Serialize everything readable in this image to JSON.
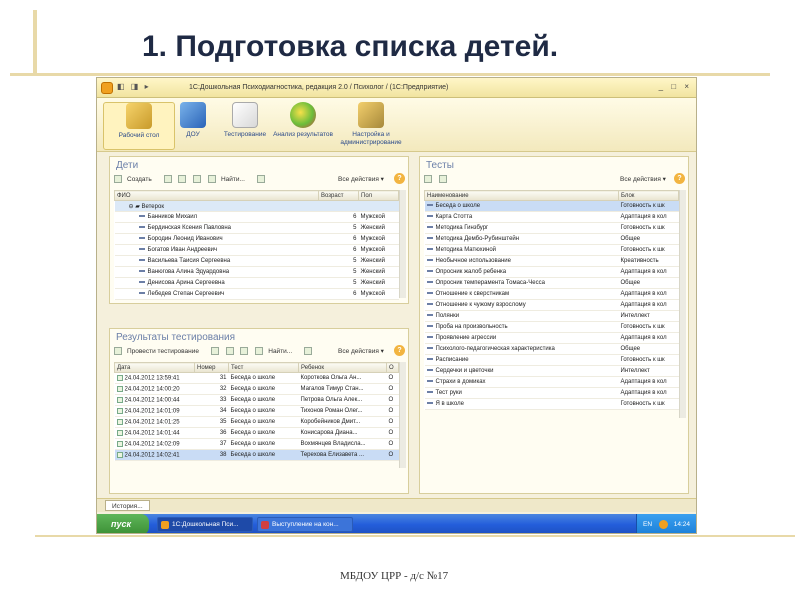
{
  "slide": {
    "title": "1. Подготовка списка детей.",
    "footer": "МБДОУ ЦРР - д/с №17"
  },
  "window": {
    "title": "1С:Дошкольная Психодиагностика, редакция 2.0 / Психолог / (1С:Предприятие)",
    "window_controls": "_ □ ×"
  },
  "toolbar": [
    {
      "label": "Рабочий стол",
      "icon": "desk-icon"
    },
    {
      "label": "ДОУ",
      "icon": "building-icon"
    },
    {
      "label": "Тестирование",
      "icon": "test-sheet-icon"
    },
    {
      "label": "Анализ результатов",
      "icon": "analysis-icon"
    },
    {
      "label": "Настройка и администрирование",
      "icon": "settings-icon"
    }
  ],
  "children_panel": {
    "title": "Дети",
    "create_label": "Создать",
    "find_label": "Найти...",
    "all_actions": "Все действия ▾",
    "columns": [
      "ФИО",
      "Возраст",
      "Пол"
    ],
    "group": "Ветерок",
    "rows": [
      {
        "name": "Банников Михаил",
        "age": "6",
        "sex": "Мужской"
      },
      {
        "name": "Бердинская Ксения Павловна",
        "age": "5",
        "sex": "Женский"
      },
      {
        "name": "Бородин Леонид Иванович",
        "age": "6",
        "sex": "Мужской"
      },
      {
        "name": "Богатов Иван Андреевич",
        "age": "6",
        "sex": "Мужской"
      },
      {
        "name": "Васильева Таисия Сергеевна",
        "age": "5",
        "sex": "Женский"
      },
      {
        "name": "Ванюгова Алина Эдуардовна",
        "age": "5",
        "sex": "Женский"
      },
      {
        "name": "Денисова Арина Сергеевна",
        "age": "5",
        "sex": "Женский"
      },
      {
        "name": "Лебедев Степан Сергеевич",
        "age": "6",
        "sex": "Мужской"
      }
    ]
  },
  "results_panel": {
    "title": "Результаты тестирования",
    "run_label": "Провести тестирование",
    "find_label": "Найти...",
    "all_actions": "Все действия ▾",
    "columns": [
      "Дата",
      "Номер",
      "Тест",
      "Ребенок",
      "О"
    ],
    "rows": [
      {
        "date": "24.04.2012 13:59:41",
        "num": "31",
        "test": "Беседа о школе",
        "child": "Короткова Ольга Ан...",
        "o": "О"
      },
      {
        "date": "24.04.2012 14:00:20",
        "num": "32",
        "test": "Беседа о школе",
        "child": "Магалов Тимур Стан...",
        "o": "О"
      },
      {
        "date": "24.04.2012 14:00:44",
        "num": "33",
        "test": "Беседа о школе",
        "child": "Петрова Ольга Алек...",
        "o": "О"
      },
      {
        "date": "24.04.2012 14:01:09",
        "num": "34",
        "test": "Беседа о школе",
        "child": "Тихонов Роман Олег...",
        "o": "О"
      },
      {
        "date": "24.04.2012 14:01:25",
        "num": "35",
        "test": "Беседа о школе",
        "child": "Коробейников Дмит...",
        "o": "О"
      },
      {
        "date": "24.04.2012 14:01:44",
        "num": "36",
        "test": "Беседа о школе",
        "child": "Конисарова Диана...",
        "o": "О"
      },
      {
        "date": "24.04.2012 14:02:09",
        "num": "37",
        "test": "Беседа о школе",
        "child": "Вохмянцев Владисла...",
        "o": "О"
      },
      {
        "date": "24.04.2012 14:02:41",
        "num": "38",
        "test": "Беседа о школе",
        "child": "Терехова Елизавета ...",
        "o": "О"
      }
    ]
  },
  "tests_panel": {
    "title": "Тесты",
    "all_actions": "Все действия ▾",
    "columns": [
      "Наименование",
      "Блок"
    ],
    "rows": [
      {
        "name": "Беседа о школе",
        "block": "Готовность к шк"
      },
      {
        "name": "Карта Стотта",
        "block": "Адаптация в кол"
      },
      {
        "name": "Методика Гинзбург",
        "block": "Готовность к шк"
      },
      {
        "name": "Методика Дембо-Рубинштейн",
        "block": "Общее"
      },
      {
        "name": "Методика Матюхиной",
        "block": "Готовность к шк"
      },
      {
        "name": "Необычное использование",
        "block": "Креативность"
      },
      {
        "name": "Опросник жалоб ребенка",
        "block": "Адаптация в кол"
      },
      {
        "name": "Опросник темперамента Томаса-Чесса",
        "block": "Общее"
      },
      {
        "name": "Отношение к сверстникам",
        "block": "Адаптация в кол"
      },
      {
        "name": "Отношение к чужому взрослому",
        "block": "Адаптация в кол"
      },
      {
        "name": "Полянки",
        "block": "Интеллект"
      },
      {
        "name": "Проба на произвольность",
        "block": "Готовность к шк"
      },
      {
        "name": "Проявление агрессии",
        "block": "Адаптация в кол"
      },
      {
        "name": "Психолого-педагогическая характеристика",
        "block": "Общее"
      },
      {
        "name": "Расписание",
        "block": "Готовность к шк"
      },
      {
        "name": "Сердечки и цветочки",
        "block": "Интеллект"
      },
      {
        "name": "Страхи в домиках",
        "block": "Адаптация в кол"
      },
      {
        "name": "Тест руки",
        "block": "Адаптация в кол"
      },
      {
        "name": "Я в школе",
        "block": "Готовность к шк"
      }
    ]
  },
  "status": {
    "history_label": "История..."
  },
  "taskbar": {
    "start_label": "пуск",
    "tasks": [
      "1С:Дошкольная Пси...",
      "Выступление на кон..."
    ],
    "lang": "EN",
    "clock": "14:24"
  }
}
